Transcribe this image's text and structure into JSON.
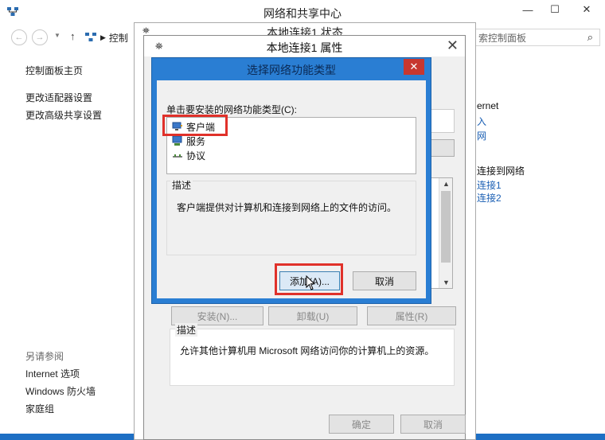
{
  "main_window": {
    "title": "网络和共享中心",
    "breadcrumb": "控制",
    "search_placeholder": "索控制面板",
    "left_pane": {
      "links": [
        "控制面板主页",
        "更改适配器设置",
        "更改高级共享设置"
      ],
      "see_also_label": "另请参阅",
      "see_also": [
        "Internet 选项",
        "Windows 防火墙",
        "家庭组"
      ]
    },
    "right_peek": {
      "internet": "ernet",
      "link1": "入",
      "link2": "网",
      "connect_header": "连接到网络",
      "conn1": "连接1",
      "conn2": "连接2"
    }
  },
  "status_window": {
    "title": "本地连接1 状态"
  },
  "properties_window": {
    "title": "本地连接1 属性",
    "buttons": {
      "install": "安装(N)...",
      "uninstall": "卸载(U)",
      "properties": "属性(R)",
      "ok": "确定",
      "cancel": "取消"
    },
    "description_label": "描述",
    "description_text": "允许其他计算机用 Microsoft 网络访问你的计算机上的资源。"
  },
  "feature_dialog": {
    "title": "选择网络功能类型",
    "prompt": "单击要安装的网络功能类型(C):",
    "items": [
      {
        "label": "客户端",
        "icon": "client-icon"
      },
      {
        "label": "服务",
        "icon": "service-icon"
      },
      {
        "label": "协议",
        "icon": "protocol-icon"
      }
    ],
    "description_label": "描述",
    "description_text": "客户端提供对计算机和连接到网络上的文件的访问。",
    "add_button": "添加(A)...",
    "cancel_button": "取消"
  },
  "colors": {
    "dialog_frame": "#2a7ed3",
    "close_red": "#c7372f",
    "highlight_red": "#e0312a",
    "link_blue": "#1a5fb4"
  }
}
